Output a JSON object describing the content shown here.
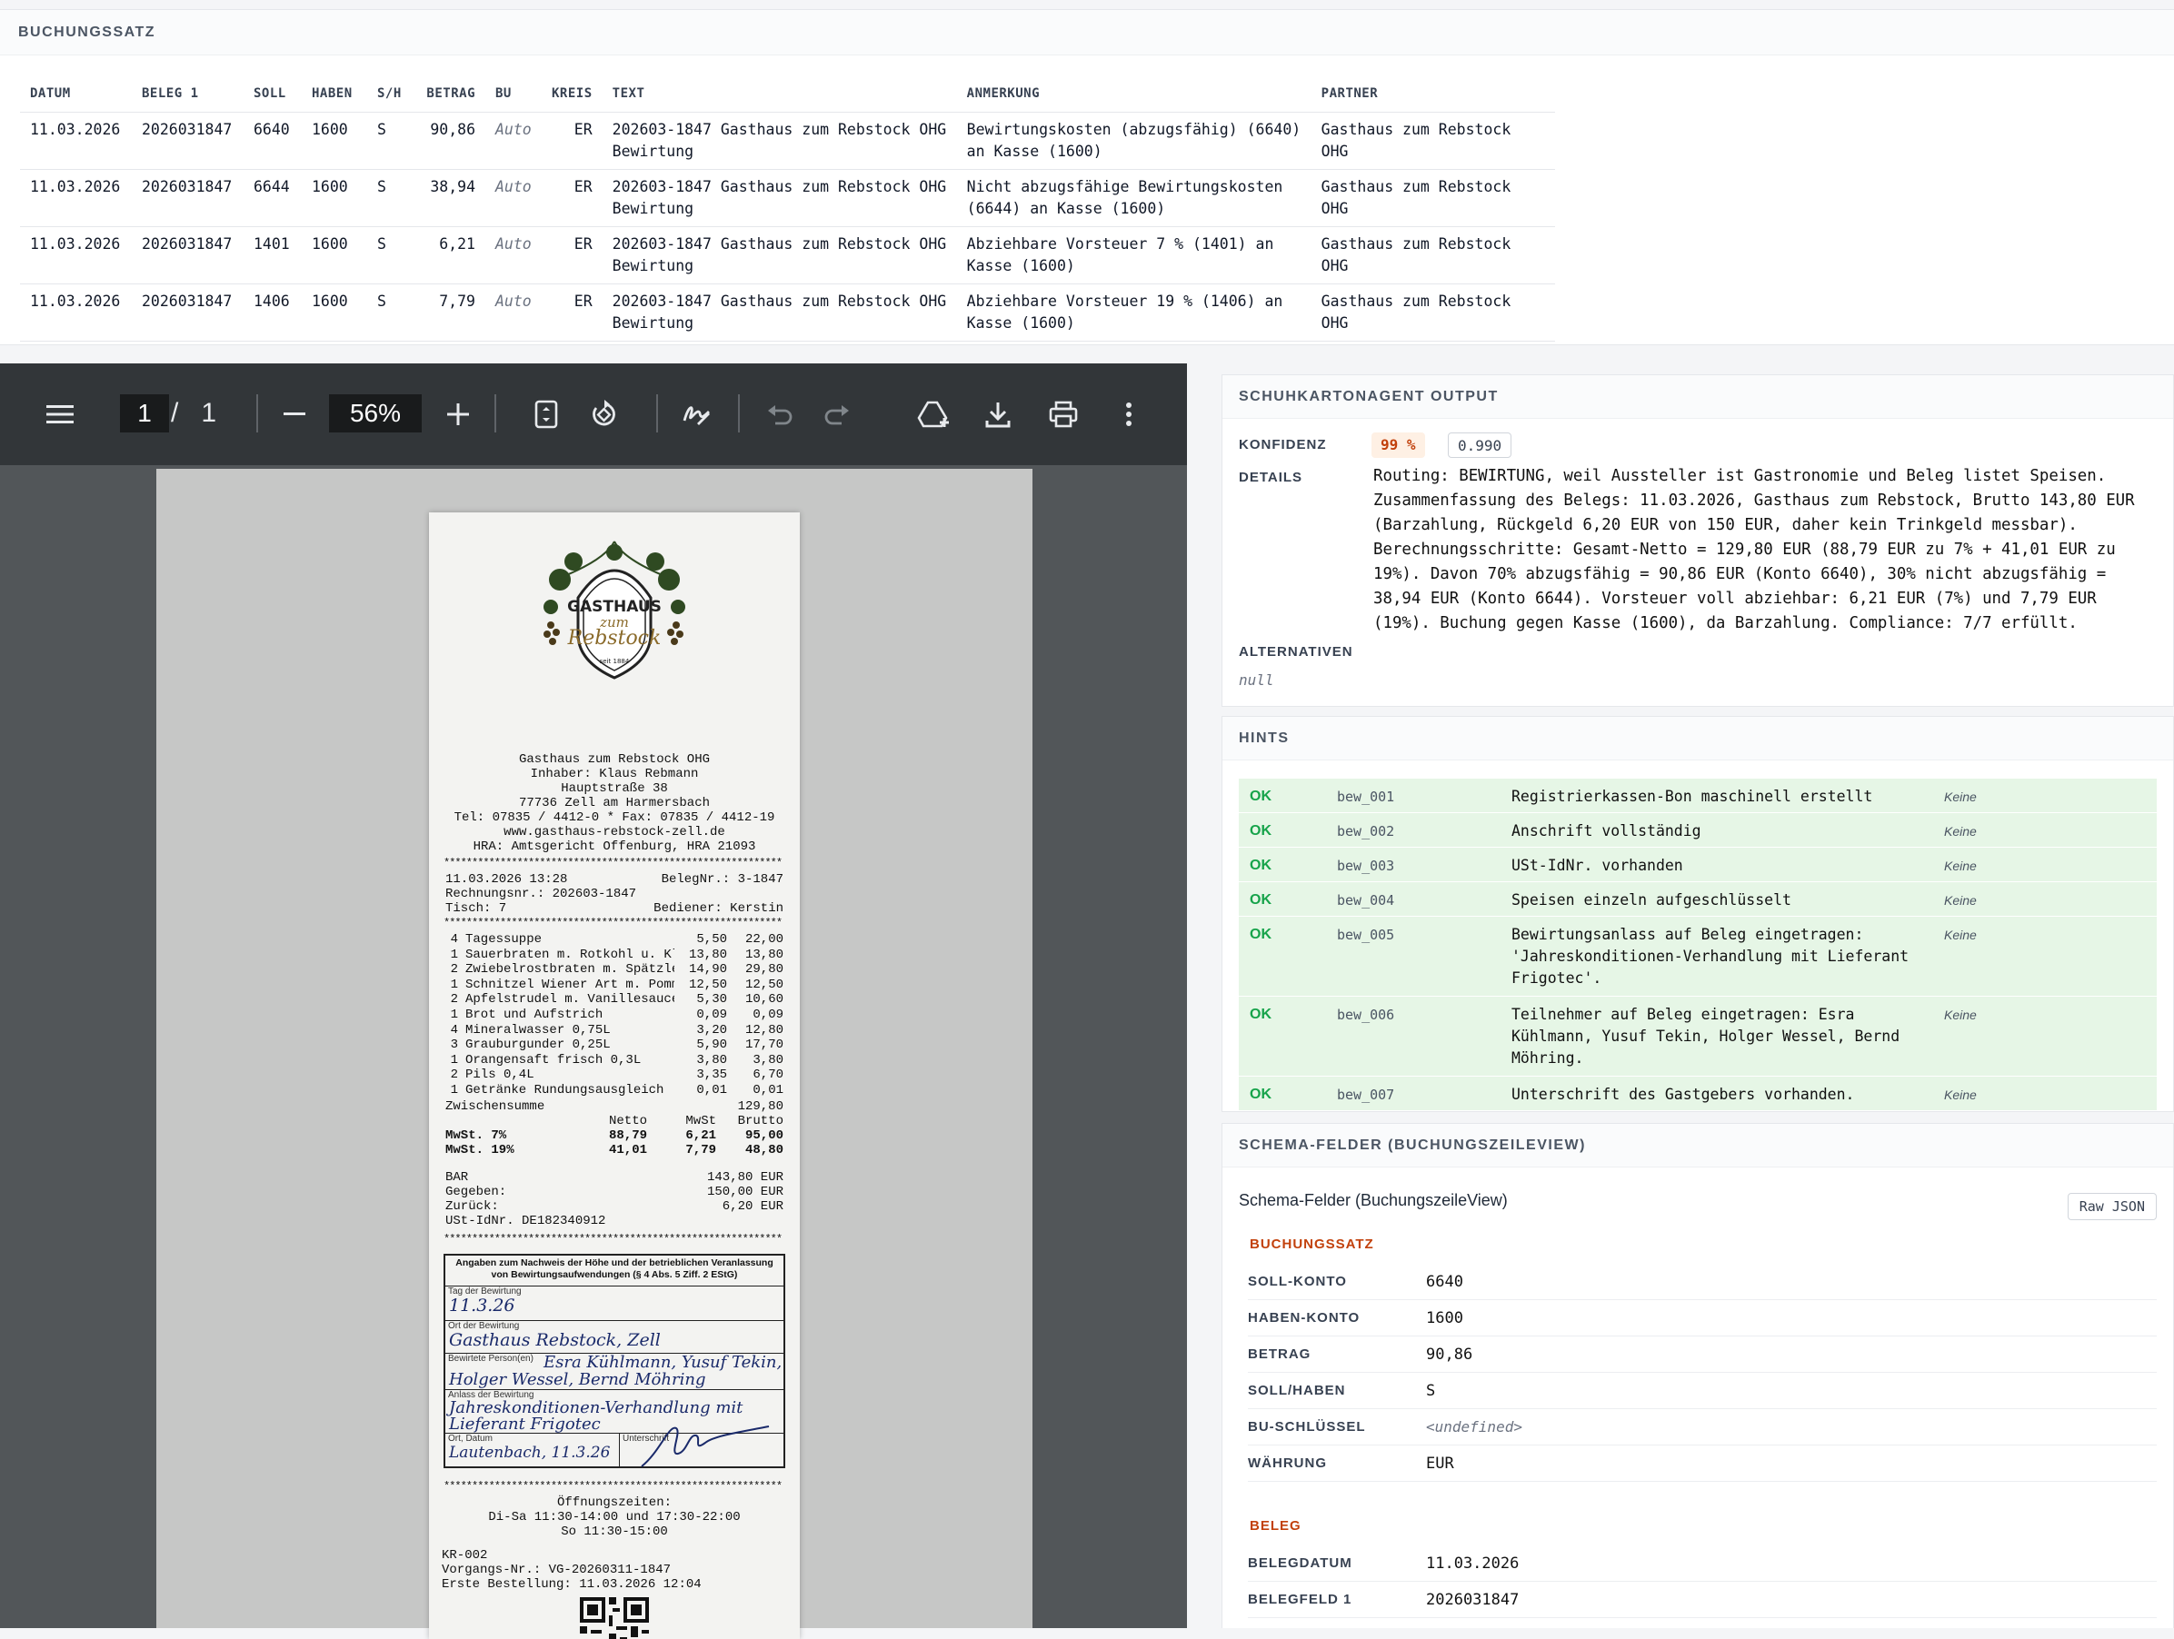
{
  "buchungssatz": {
    "title": "BUCHUNGSSATZ",
    "columns": [
      "DATUM",
      "BELEG 1",
      "SOLL",
      "HABEN",
      "S/H",
      "BETRAG",
      "BU",
      "KREIS",
      "TEXT",
      "ANMERKUNG",
      "PARTNER"
    ],
    "rows": [
      {
        "datum": "11.03.2026",
        "beleg": "2026031847",
        "soll": "6640",
        "haben": "1600",
        "sh": "S",
        "betrag": "90,86",
        "bu": "Auto",
        "kreis": "ER",
        "text": "202603-1847 Gasthaus zum Rebstock OHG Bewirtung",
        "anmerkung": "Bewirtungskosten (abzugsfähig) (6640) an Kasse (1600)",
        "partner": "Gasthaus zum Rebstock OHG"
      },
      {
        "datum": "11.03.2026",
        "beleg": "2026031847",
        "soll": "6644",
        "haben": "1600",
        "sh": "S",
        "betrag": "38,94",
        "bu": "Auto",
        "kreis": "ER",
        "text": "202603-1847 Gasthaus zum Rebstock OHG Bewirtung",
        "anmerkung": "Nicht abzugsfähige Bewirtungskosten (6644) an Kasse (1600)",
        "partner": "Gasthaus zum Rebstock OHG"
      },
      {
        "datum": "11.03.2026",
        "beleg": "2026031847",
        "soll": "1401",
        "haben": "1600",
        "sh": "S",
        "betrag": "6,21",
        "bu": "Auto",
        "kreis": "ER",
        "text": "202603-1847 Gasthaus zum Rebstock OHG Bewirtung",
        "anmerkung": "Abziehbare Vorsteuer 7 % (1401) an Kasse (1600)",
        "partner": "Gasthaus zum Rebstock OHG"
      },
      {
        "datum": "11.03.2026",
        "beleg": "2026031847",
        "soll": "1406",
        "haben": "1600",
        "sh": "S",
        "betrag": "7,79",
        "bu": "Auto",
        "kreis": "ER",
        "text": "202603-1847 Gasthaus zum Rebstock OHG Bewirtung",
        "anmerkung": "Abziehbare Vorsteuer 19 % (1406) an Kasse (1600)",
        "partner": "Gasthaus zum Rebstock OHG"
      }
    ]
  },
  "pdf_viewer": {
    "page_current": "1",
    "page_total": "1",
    "page_sep": "/",
    "zoom": "56%",
    "icons": [
      "menu-icon",
      "zoom-out-icon",
      "zoom-in-icon",
      "fit-page-icon",
      "rotate-icon",
      "annotate-icon",
      "undo-icon",
      "redo-icon",
      "save-to-drive-icon",
      "download-icon",
      "print-icon",
      "more-icon"
    ]
  },
  "receipt": {
    "logo_line1": "GASTHAUS",
    "logo_line2": "zum",
    "logo_line3": "Rebstock",
    "logo_since": "seit 1884",
    "header": [
      "Gasthaus zum Rebstock OHG",
      "Inhaber: Klaus Rebmann",
      "Hauptstraße 38",
      "77736 Zell am Harmersbach",
      "Tel: 07835 / 4412-0 * Fax: 07835 / 4412-19",
      "www.gasthaus-rebstock-zell.de",
      "HRA: Amtsgericht Offenburg, HRA 21093"
    ],
    "datetime": "11.03.2026 13:28",
    "belegnr": "BelegNr.: 3-1847",
    "rechnungsnr": "Rechnungsnr.: 202603-1847",
    "tisch": "Tisch: 7",
    "bediener": "Bediener: Kerstin",
    "items": [
      {
        "q": "4",
        "n": "Tagessuppe",
        "p": "5,50",
        "t": "22,00"
      },
      {
        "q": "1",
        "n": "Sauerbraten m. Rotkohl u. Kloß",
        "p": "13,80",
        "t": "13,80"
      },
      {
        "q": "2",
        "n": "Zwiebelrostbraten m. Spätzle",
        "p": "14,90",
        "t": "29,80"
      },
      {
        "q": "1",
        "n": "Schnitzel Wiener Art m. Pommes",
        "p": "12,50",
        "t": "12,50"
      },
      {
        "q": "2",
        "n": "Apfelstrudel m. Vanillesauce",
        "p": "5,30",
        "t": "10,60"
      },
      {
        "q": "1",
        "n": "Brot und Aufstrich",
        "p": "0,09",
        "t": "0,09"
      },
      {
        "q": "4",
        "n": "Mineralwasser 0,75L",
        "p": "3,20",
        "t": "12,80"
      },
      {
        "q": "3",
        "n": "Grauburgunder 0,25L",
        "p": "5,90",
        "t": "17,70"
      },
      {
        "q": "1",
        "n": "Orangensaft frisch 0,3L",
        "p": "3,80",
        "t": "3,80"
      },
      {
        "q": "2",
        "n": "Pils 0,4L",
        "p": "3,35",
        "t": "6,70"
      },
      {
        "q": "1",
        "n": "Getränke Rundungsausgleich",
        "p": "0,01",
        "t": "0,01"
      }
    ],
    "zwischensumme_label": "Zwischensumme",
    "zwischensumme": "129,80",
    "tax_head": [
      "Netto",
      "MwSt",
      "Brutto"
    ],
    "tax_rows": [
      {
        "l": "MwSt. 7%",
        "n": "88,79",
        "m": "6,21",
        "b": "95,00"
      },
      {
        "l": "MwSt. 19%",
        "n": "41,01",
        "m": "7,79",
        "b": "48,80"
      }
    ],
    "bar_label": "BAR",
    "bar": "143,80 EUR",
    "gegeben_label": "Gegeben:",
    "gegeben": "150,00 EUR",
    "zurueck_label": "Zurück:",
    "zurueck": "6,20 EUR",
    "ustid": "USt-IdNr. DE182340912",
    "form_title": "Angaben zum Nachweis der Höhe und der betrieblichen Veranlassung von Bewirtungsaufwendungen (§ 4 Abs. 5 Ziff. 2 EStG)",
    "form_tag_label": "Tag der Bewirtung",
    "form_tag": "11.3.26",
    "form_ort_label": "Ort der Bewirtung",
    "form_ort": "Gasthaus Rebstock, Zell",
    "form_pers_label": "Bewirtete Person(en)",
    "form_pers1": "Esra Kühlmann, Yusuf Tekin,",
    "form_pers2": "Holger Wessel, Bernd Möhring",
    "form_anlass_label": "Anlass der Bewirtung",
    "form_anlass1": "Jahreskonditionen-Verhandlung mit",
    "form_anlass2": "Lieferant Frigotec",
    "form_ortdatum_label": "Ort, Datum",
    "form_ortdatum": "Lautenbach, 11.3.26",
    "form_sign_label": "Unterschrift",
    "oeffnung_title": "Öffnungszeiten:",
    "oeffnung1": "Di-Sa 11:30-14:00 und 17:30-22:00",
    "oeffnung2": "So 11:30-15:00",
    "kr": "KR-002",
    "vorgang": "Vorgangs-Nr.: VG-20260311-1847",
    "erste": "Erste Bestellung: 11.03.2026 12:04"
  },
  "agent_output": {
    "title": "SCHUHKARTONAGENT OUTPUT",
    "konfidenz_label": "KONFIDENZ",
    "konfidenz_pct": "99 %",
    "konfidenz_val": "0.990",
    "details_label": "DETAILS",
    "details": "Routing: BEWIRTUNG, weil Aussteller ist Gastronomie und Beleg listet Speisen. Zusammenfassung des Belegs: 11.03.2026, Gasthaus zum Rebstock, Brutto 143,80 EUR (Barzahlung, Rückgeld 6,20 EUR von 150 EUR, daher kein Trinkgeld messbar). Berechnungsschritte: Gesamt-Netto = 129,80 EUR (88,79 EUR zu 7% + 41,01 EUR zu 19%). Davon 70% abzugsfähig = 90,86 EUR (Konto 6640), 30% nicht abzugsfähig = 38,94 EUR (Konto 6644). Vorsteuer voll abziehbar: 6,21 EUR (7%) und 7,79 EUR (19%). Buchung gegen Kasse (1600), da Barzahlung. Compliance: 7/7 erfüllt.",
    "alternativen_label": "ALTERNATIVEN",
    "alternativen": "null",
    "konfidenz_color": "#c2410c"
  },
  "hints": {
    "title": "HINTS",
    "rows": [
      {
        "status": "OK",
        "id": "bew_001",
        "text": "Registrierkassen-Bon maschinell erstellt",
        "extra": "Keine"
      },
      {
        "status": "OK",
        "id": "bew_002",
        "text": "Anschrift vollständig",
        "extra": "Keine"
      },
      {
        "status": "OK",
        "id": "bew_003",
        "text": "USt-IdNr. vorhanden",
        "extra": "Keine"
      },
      {
        "status": "OK",
        "id": "bew_004",
        "text": "Speisen einzeln aufgeschlüsselt",
        "extra": "Keine"
      },
      {
        "status": "OK",
        "id": "bew_005",
        "text": "Bewirtungsanlass auf Beleg eingetragen: 'Jahreskonditionen-Verhandlung mit Lieferant Frigotec'.",
        "extra": "Keine"
      },
      {
        "status": "OK",
        "id": "bew_006",
        "text": "Teilnehmer auf Beleg eingetragen: Esra Kühlmann, Yusuf Tekin, Holger Wessel, Bernd Möhring.",
        "extra": "Keine"
      },
      {
        "status": "OK",
        "id": "bew_007",
        "text": "Unterschrift des Gastgebers vorhanden.",
        "extra": "Keine"
      }
    ],
    "ok_color": "#16a34a"
  },
  "schema": {
    "title": "SCHEMA-FELDER (BUCHUNGSZEILEVIEW)",
    "subtitle": "Schema-Felder (BuchungszeileView)",
    "raw_button": "Raw JSON",
    "group1": "BUCHUNGSSATZ",
    "fields1": [
      {
        "k": "SOLL-KONTO",
        "v": "6640"
      },
      {
        "k": "HABEN-KONTO",
        "v": "1600"
      },
      {
        "k": "BETRAG",
        "v": "90,86"
      },
      {
        "k": "SOLL/HABEN",
        "v": "S"
      },
      {
        "k": "BU-SCHLÜSSEL",
        "v": "<undefined>"
      },
      {
        "k": "WÄHRUNG",
        "v": "EUR"
      }
    ],
    "group2": "BELEG",
    "fields2": [
      {
        "k": "BELEGDATUM",
        "v": "11.03.2026"
      },
      {
        "k": "BELEGFELD 1",
        "v": "2026031847"
      }
    ]
  }
}
